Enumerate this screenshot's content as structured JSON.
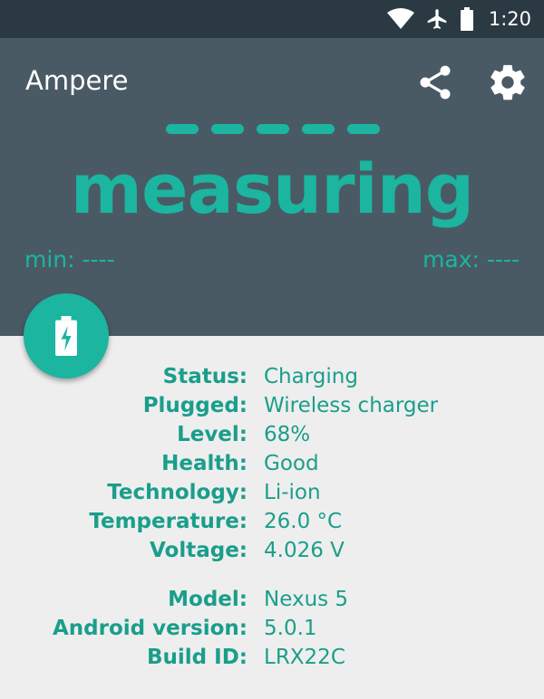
{
  "statusbar": {
    "time": "1:20",
    "icons": [
      "wifi-icon",
      "airplane-mode-icon",
      "battery-icon"
    ]
  },
  "appbar": {
    "title": "Ampere",
    "actions": [
      "share-icon",
      "settings-gear-icon"
    ]
  },
  "meter": {
    "placeholder_dashes": 5,
    "reading": "measuring",
    "min_label": "min: ----",
    "max_label": "max: ----"
  },
  "fab": {
    "icon": "battery-charging-icon"
  },
  "battery": [
    {
      "label": "Status:",
      "value": "Charging"
    },
    {
      "label": "Plugged:",
      "value": "Wireless charger"
    },
    {
      "label": "Level:",
      "value": "68%"
    },
    {
      "label": "Health:",
      "value": "Good"
    },
    {
      "label": "Technology:",
      "value": "Li-ion"
    },
    {
      "label": "Temperature:",
      "value": "26.0 °C"
    },
    {
      "label": "Voltage:",
      "value": "4.026 V"
    }
  ],
  "device": [
    {
      "label": "Model:",
      "value": "Nexus 5"
    },
    {
      "label": "Android version:",
      "value": "5.0.1"
    },
    {
      "label": "Build ID:",
      "value": "LRX22C"
    }
  ],
  "colors": {
    "accent": "#1bb5a0",
    "appbar": "#4a5a65",
    "statusbar": "#2b3a42",
    "background": "#eeeeee"
  }
}
